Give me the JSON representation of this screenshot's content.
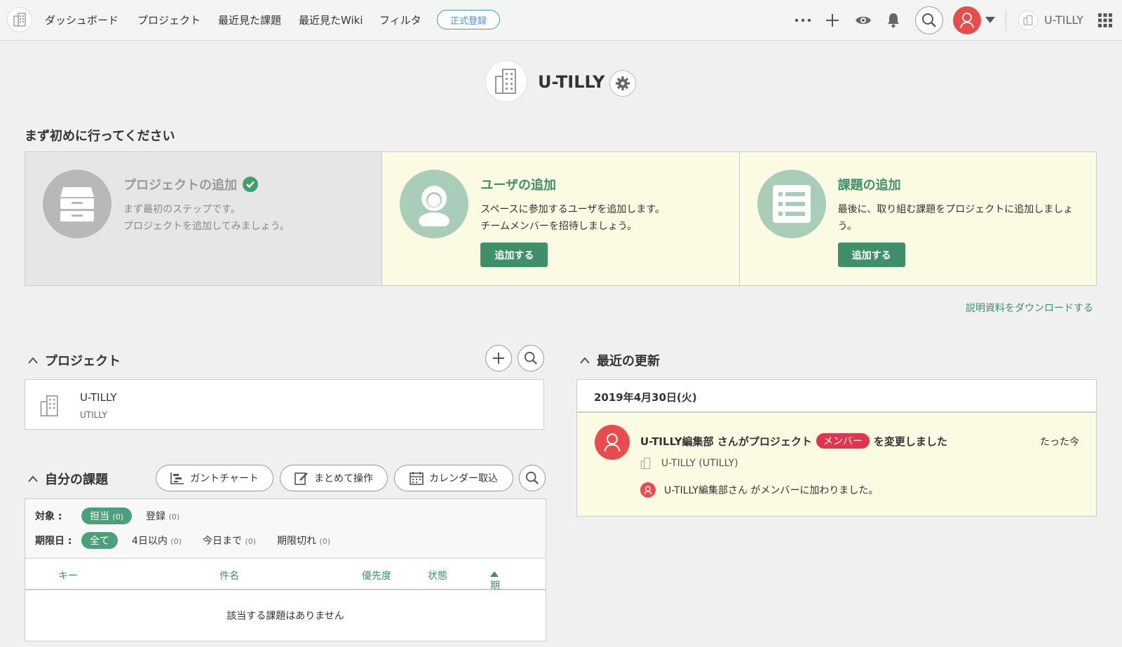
{
  "nav": {
    "items": [
      "ダッシュボード",
      "プロジェクト",
      "最近見た課題",
      "最近見たWiki",
      "フィルタ"
    ],
    "register_label": "正式登録",
    "space_name": "U-TILLY",
    "more_icon": "more-icon",
    "add_icon": "plus-icon",
    "watch_icon": "eye-icon",
    "notify_icon": "bell-icon",
    "search_icon": "search-icon",
    "apps_icon": "grid-icon"
  },
  "space": {
    "title": "U-TILLY",
    "settings_icon": "gear-icon"
  },
  "onboarding": {
    "heading": "まず初めに行ってください",
    "cards": [
      {
        "title": "プロジェクトの追加",
        "desc1": "まず最初のステップです。",
        "desc2": "プロジェクトを追加してみましょう。",
        "done": true,
        "icon": "cabinet-icon"
      },
      {
        "title": "ユーザの追加",
        "desc1": "スペースに参加するユーザを追加します。",
        "desc2": "チームメンバーを招待しましょう。",
        "button": "追加する",
        "icon": "user-icon"
      },
      {
        "title": "課題の追加",
        "desc1": "最後に、取り組む課題をプロジェクトに追加しましょう。",
        "desc2": "",
        "button": "追加する",
        "icon": "list-icon"
      }
    ],
    "download_link": "説明資料をダウンロードする"
  },
  "projects": {
    "heading": "プロジェクト",
    "items": [
      {
        "name": "U-TILLY",
        "key": "UTILLY"
      }
    ]
  },
  "my_issues": {
    "heading": "自分の課題",
    "buttons": {
      "gantt": "ガントチャート",
      "bulk": "まとめて操作",
      "calendar": "カレンダー取込"
    },
    "filter_target_label": "対象 :",
    "filter_target": {
      "assigned": "担当",
      "assigned_count": "(0)",
      "registered": "登録",
      "registered_count": "(0)"
    },
    "filter_due_label": "期限日 :",
    "filter_due": {
      "all": "全て",
      "within4": "4日以内",
      "within4_count": "(0)",
      "today": "今日まで",
      "today_count": "(0)",
      "overdue": "期限切れ",
      "overdue_count": "(0)"
    },
    "columns": {
      "key": "キー",
      "subject": "件名",
      "priority": "優先度",
      "status": "状態",
      "due": "期限日"
    },
    "empty": "該当する課題はありません"
  },
  "updates": {
    "heading": "最近の更新",
    "date": "2019年4月30日(火)",
    "entry": {
      "actor": "U-TILLY編集部 さんがプロジェクト",
      "badge": "メンバー",
      "action": "を変更しました",
      "time": "たった今",
      "project": "U-TILLY (UTILLY)",
      "detail": "U-TILLY編集部さん がメンバーに加わりました。"
    }
  },
  "colors": {
    "accent": "#3f8f6a",
    "badge": "#e0344f",
    "avatar": "#e84c4c",
    "card_bg": "#fbfae2"
  }
}
